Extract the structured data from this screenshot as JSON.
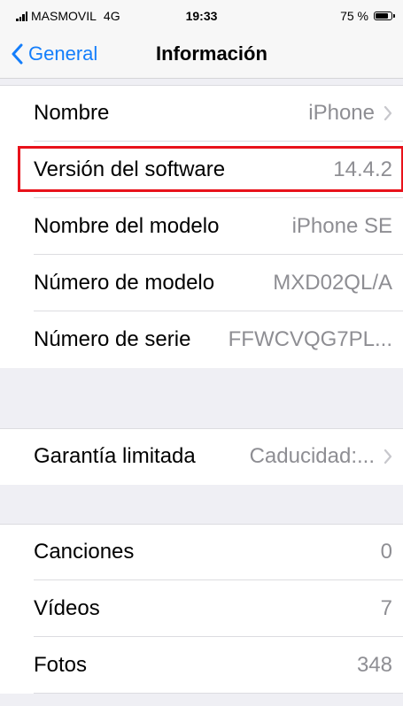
{
  "status": {
    "carrier": "MASMOVIL",
    "network": "4G",
    "time": "19:33",
    "battery_text": "75 %",
    "battery_level": 0.75
  },
  "nav": {
    "back_label": "General",
    "title": "Información"
  },
  "section1": [
    {
      "label": "Nombre",
      "value": "iPhone",
      "chevron": true
    },
    {
      "label": "Versión del software",
      "value": "14.4.2",
      "chevron": false
    },
    {
      "label": "Nombre del modelo",
      "value": "iPhone SE",
      "chevron": false
    },
    {
      "label": "Número de modelo",
      "value": "MXD02QL/A",
      "chevron": false
    },
    {
      "label": "Número de serie",
      "value": "FFWCVQG7PL...",
      "chevron": false
    }
  ],
  "section2": [
    {
      "label": "Garantía limitada",
      "value": "Caducidad:...",
      "chevron": true
    }
  ],
  "section3": [
    {
      "label": "Canciones",
      "value": "0"
    },
    {
      "label": "Vídeos",
      "value": "7"
    },
    {
      "label": "Fotos",
      "value": "348"
    }
  ],
  "colors": {
    "accent": "#147efb",
    "highlight": "#e8121b",
    "secondary_text": "#8e8e93"
  }
}
